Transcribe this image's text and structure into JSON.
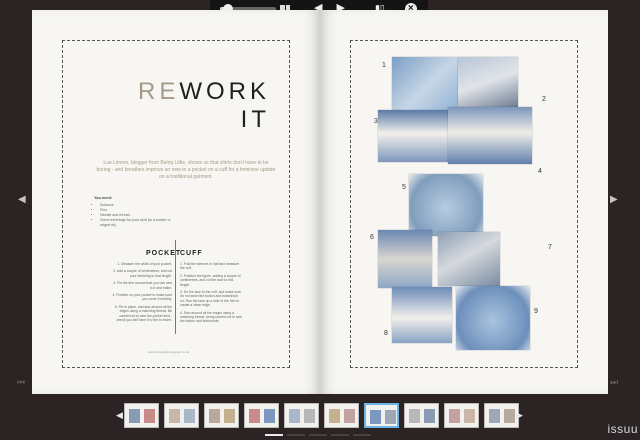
{
  "toolbar": {
    "zoom_level": 0.15,
    "prev_label": "◀",
    "next_label": "▶",
    "icons": [
      "view-icon",
      "prev-icon",
      "next-icon",
      "share-icon",
      "close-icon"
    ]
  },
  "left_page": {
    "headline_accent": "RE",
    "headline_rest": "WORK",
    "headline_line2": "IT",
    "intro": "Lue Limem, blogger from Being Little, shows us that shirts don't have to be boring - and breathes improve an new to a pocket on a cuff for a feminine update on a traditional garment.",
    "needs_title": "You need:",
    "needs": [
      "Scissors",
      "Pins",
      "Needle and thread",
      "Some trimmings for your shirt (to a border or edged ok)"
    ],
    "pocket_title": "POCKET",
    "cuff_title": "CUFF",
    "pocket_steps": [
      "1. Measure the width of your pocket.",
      "2. Add a couple of centimetres, and cut your trimming to that length.",
      "3. Pin the trim around that you can sew to it and make.",
      "4. Position on your pocket to make sure you cover it entirely.",
      "5. Pin in place, and sew around all the edges using a matching thread. Be careful not to sew the pocket shut - check you still have it to the to insert."
    ],
    "cuff_steps": [
      "1. Fold the sleeves in half and measure the cuff.",
      "2. Position the figure, adding a couple of centimetres, and cut the lace to this length.",
      "3. Do the lace to the cuff, and make sure it's not sewn the button and buttonhole on. Run the lace up a side of the trim to create a clean edge.",
      "4. Sew around all the edges using a matching thread, being careful not to sew the button and buttonhole."
    ],
    "credit": "www.being-little.blogspot.co.uk"
  },
  "right_page": {
    "photo_numbers": [
      "1",
      "2",
      "3",
      "4",
      "5",
      "6",
      "7",
      "8",
      "9"
    ]
  },
  "nav": {
    "left_arrow": "◀",
    "right_arrow": "▶",
    "first_page": "⏮",
    "last_page": "⏭",
    "strip_left": "◀",
    "strip_right": "▶"
  },
  "thumbnails": {
    "count": 10,
    "active_index": 6
  },
  "brand": "issuu",
  "colors": {
    "background": "#2b2324",
    "accent_text": "#a59a88",
    "active_thumb": "#6cb4e6"
  }
}
